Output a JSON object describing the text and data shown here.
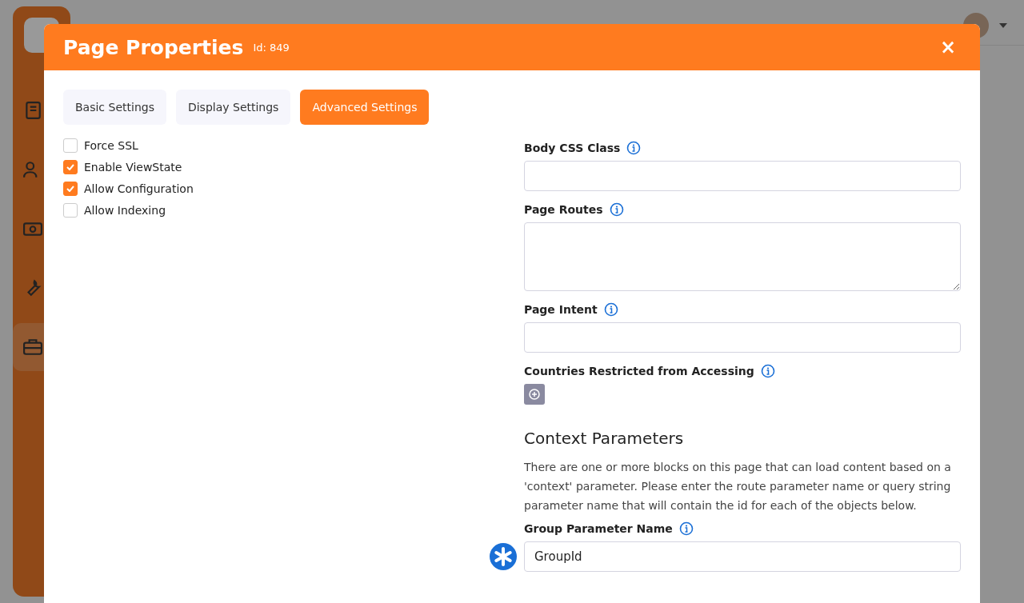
{
  "app": {
    "sidebar_items": [
      {
        "kind": "book",
        "selected": false
      },
      {
        "kind": "people",
        "selected": false
      },
      {
        "kind": "money",
        "selected": false
      },
      {
        "kind": "wrench",
        "selected": false
      },
      {
        "kind": "briefcase",
        "selected": true
      }
    ]
  },
  "modal": {
    "title": "Page Properties",
    "id_label": "Id: 849",
    "close": "×",
    "tabs": [
      {
        "label": "Basic Settings",
        "selected": false
      },
      {
        "label": "Display Settings",
        "selected": false
      },
      {
        "label": "Advanced Settings",
        "selected": true
      }
    ],
    "checkboxes": [
      {
        "label": "Force SSL",
        "checked": false
      },
      {
        "label": "Enable ViewState",
        "checked": true
      },
      {
        "label": "Allow Configuration",
        "checked": true
      },
      {
        "label": "Allow Indexing",
        "checked": false
      }
    ],
    "fields": [
      {
        "kind": "text",
        "label": "Body CSS Class"
      },
      {
        "kind": "textarea",
        "label": "Page Routes"
      },
      {
        "kind": "text",
        "label": "Page Intent"
      },
      {
        "kind": "picker",
        "label": "Countries Restricted from Accessing"
      }
    ],
    "section": {
      "heading": "Context Parameters",
      "description": "There are one or more blocks on this page that can load content based on a 'context' parameter. Please enter the route parameter name or query string parameter name that will contain the id for each of the objects below."
    },
    "context_fields": [
      {
        "kind": "text",
        "label": "Group Parameter Name",
        "value": "GroupId",
        "required": true
      }
    ]
  }
}
